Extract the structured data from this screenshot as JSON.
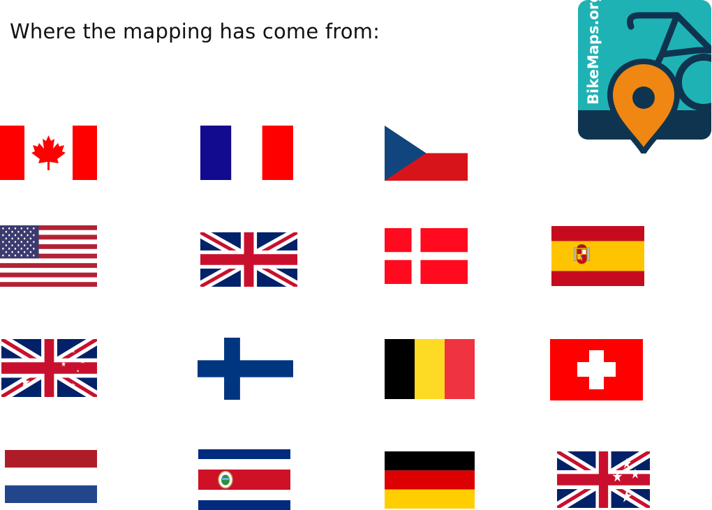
{
  "title": "Where the mapping has come from:",
  "logo": {
    "text": "BikeMaps.org",
    "icon": "bike-map-pin-icon",
    "colors": {
      "teal": "#1fb2b4",
      "navy": "#0f3450",
      "orange": "#ef8712"
    }
  },
  "flags": [
    {
      "country": "Canada",
      "icon": "canada-flag-icon"
    },
    {
      "country": "France",
      "icon": "france-flag-icon"
    },
    {
      "country": "Czech Republic",
      "icon": "czech-flag-icon"
    },
    {
      "country": "United States",
      "icon": "usa-flag-icon"
    },
    {
      "country": "United Kingdom",
      "icon": "uk-flag-icon"
    },
    {
      "country": "Denmark",
      "icon": "denmark-flag-icon"
    },
    {
      "country": "Spain",
      "icon": "spain-flag-icon"
    },
    {
      "country": "Australia",
      "icon": "australia-flag-icon"
    },
    {
      "country": "Finland",
      "icon": "finland-flag-icon"
    },
    {
      "country": "Belgium",
      "icon": "belgium-flag-icon"
    },
    {
      "country": "Switzerland",
      "icon": "switzerland-flag-icon"
    },
    {
      "country": "Netherlands",
      "icon": "netherlands-flag-icon"
    },
    {
      "country": "Costa Rica",
      "icon": "costa-rica-flag-icon"
    },
    {
      "country": "Germany",
      "icon": "germany-flag-icon"
    },
    {
      "country": "New Zealand",
      "icon": "new-zealand-flag-icon"
    }
  ]
}
